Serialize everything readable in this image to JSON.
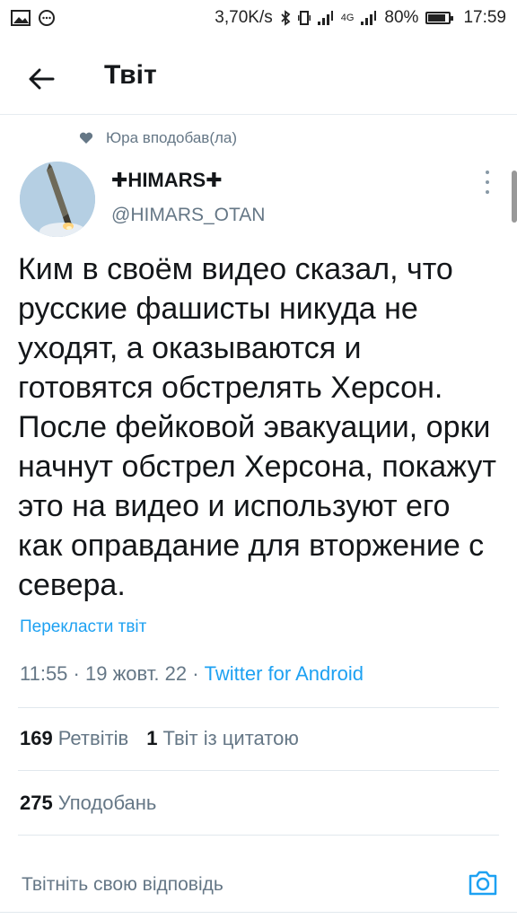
{
  "status_bar": {
    "speed": "3,70K/s",
    "network": "4G",
    "battery": "80%",
    "time": "17:59"
  },
  "header": {
    "title": "Твіт"
  },
  "social_context": {
    "text": "Юра вподобав(ла)"
  },
  "tweet": {
    "author_name": "✚HIMARS✚",
    "author_handle": "@HIMARS_OTAN",
    "text": "Ким в своём видео сказал, что русские фашисты никуда не уходят, а оказываются и готовятся обстрелять Херсон. После фейковой эвакуации, орки начнут обстрел Херсона, покажут это на видео и используют его как оправдание для вторжение с севера.",
    "translate_label": "Перекласти твіт",
    "time": "11:55",
    "date": "19 жовт. 22",
    "source": "Twitter for Android",
    "retweets_count": "169",
    "retweets_label": "Ретвітів",
    "quotes_count": "1",
    "quotes_label": "Твіт із цитатою",
    "likes_count": "275",
    "likes_label": "Уподобань"
  },
  "reply": {
    "placeholder": "Твітніть свою відповідь"
  },
  "colors": {
    "accent": "#1da1f2",
    "secondary_text": "#657786",
    "divider": "#e1e8ed"
  }
}
